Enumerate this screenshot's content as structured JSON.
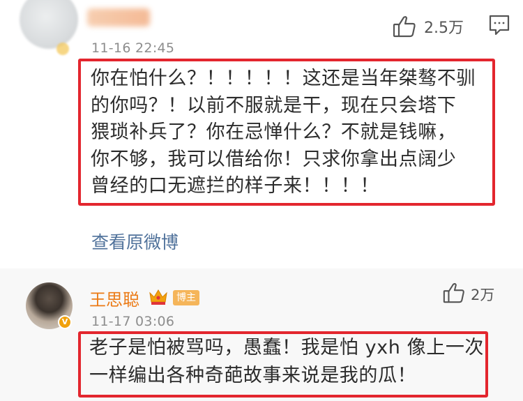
{
  "comment1": {
    "username": "",
    "likes": "2.5万",
    "timestamp": "11-16 22:45",
    "lines": [
      "你在怕什么？！！！！！这还是当年桀骜不驯",
      "的你吗？！以前不服就是干，现在只会塔下",
      "猥琐补兵了？你在忌惮什么？不就是钱嘛，",
      "你不够，我可以借给你！只求你拿出点阔少",
      "曾经的口无遮拦的样子来！！！！"
    ],
    "view_original": "查看原微博",
    "icons": {
      "like": "thumbs-up-icon",
      "comment": "comment-bubble-icon"
    }
  },
  "comment2": {
    "username": "王思聪",
    "badge": "博主",
    "likes": "2万",
    "timestamp": "11-17 03:06",
    "verified_mark": "V",
    "lines": [
      "老子是怕被骂吗，愚蠢！我是怕 yxh 像上一次",
      "一样编出各种奇葩故事来说是我的瓜！"
    ],
    "icons": {
      "like": "thumbs-up-icon",
      "crown": "crown-icon"
    }
  },
  "colors": {
    "highlight_box": "#e3262e",
    "link": "#50729b",
    "username_vip": "#eb7a15",
    "badge_bg": "#f5b55a",
    "timestamp": "#8d8d8d"
  }
}
